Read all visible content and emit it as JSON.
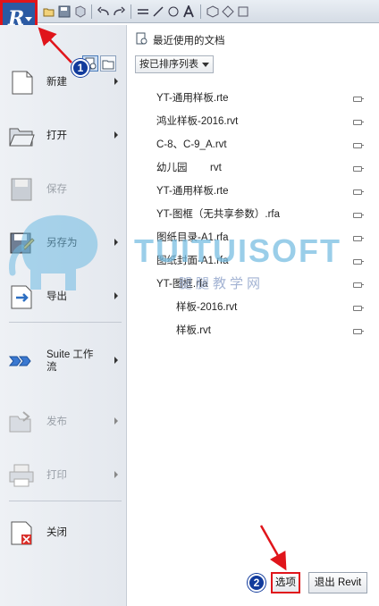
{
  "toolbar": {
    "app_button": "R",
    "icons": [
      "open-icon",
      "save-icon",
      "sync-icon",
      "undo-icon",
      "redo-icon",
      "align-icon",
      "measure-icon",
      "tag-icon",
      "text-icon",
      "3d-view-icon",
      "section-icon",
      "settings-icon"
    ]
  },
  "menu": {
    "items": [
      {
        "label": "新建",
        "icon": "new-document-icon",
        "enabled": true,
        "submenu": true
      },
      {
        "label": "打开",
        "icon": "open-folder-icon",
        "enabled": true,
        "submenu": true
      },
      {
        "label": "保存",
        "icon": "save-disk-icon",
        "enabled": false,
        "submenu": false
      },
      {
        "label": "另存为",
        "icon": "save-as-icon",
        "enabled": true,
        "submenu": true
      },
      {
        "label": "导出",
        "icon": "export-icon",
        "enabled": true,
        "submenu": true
      },
      {
        "label": "Suite 工作流",
        "icon": "suite-workflow-icon",
        "enabled": true,
        "submenu": true
      },
      {
        "label": "发布",
        "icon": "publish-icon",
        "enabled": false,
        "submenu": true
      },
      {
        "label": "打印",
        "icon": "print-icon",
        "enabled": false,
        "submenu": true
      },
      {
        "label": "关闭",
        "icon": "close-document-icon",
        "enabled": true,
        "submenu": false
      }
    ]
  },
  "recent": {
    "title": "最近使用的文档",
    "sort_label": "按已排序列表",
    "documents": [
      {
        "name": "YT-通用样板.rte",
        "indent": false
      },
      {
        "name": "鸿业样板-2016.rvt",
        "indent": false
      },
      {
        "name": "C-8、C-9_A.rvt",
        "indent": false
      },
      {
        "name": "幼儿园        rvt",
        "indent": false
      },
      {
        "name": "YT-通用样板.rte",
        "indent": false
      },
      {
        "name": "YT-图框（无共享参数）.rfa",
        "indent": false
      },
      {
        "name": "图纸目录-A1.rfa",
        "indent": false
      },
      {
        "name": "图纸封面-A1.rfa",
        "indent": false
      },
      {
        "name": "YT-图框.rfa",
        "indent": false
      },
      {
        "name": "样板-2016.rvt",
        "indent": true
      },
      {
        "name": "样板.rvt",
        "indent": true
      }
    ]
  },
  "footer": {
    "options_label": "选项",
    "exit_label": "退出 Revit"
  },
  "annotations": {
    "badge_1": "1",
    "badge_2": "2",
    "highlight_color": "#e0151b",
    "badge_color": "#123b9c"
  },
  "watermark": {
    "text": "TUITUISOFT",
    "subtext": "腿腿教学网"
  }
}
